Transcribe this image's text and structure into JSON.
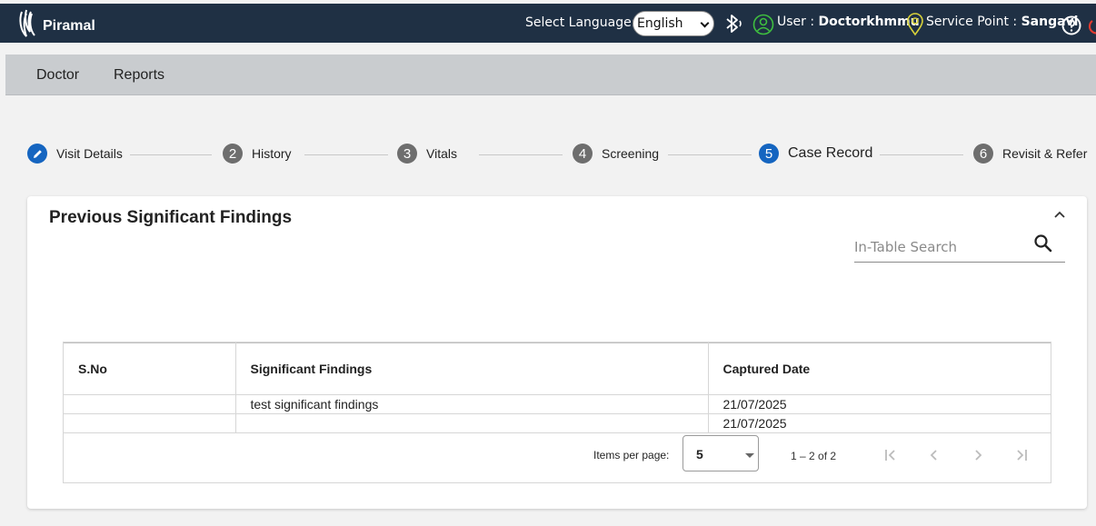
{
  "header": {
    "brand": "Piramal",
    "language_label": "Select Language:",
    "language_value": "English",
    "user_label": "User :",
    "user_name": "Doctorkhmmu",
    "service_point_label": "Service Point :",
    "service_point_name": "Sangavi",
    "colors": {
      "bar": "#1f3044",
      "icon_green": "#3fbf3f",
      "icon_yellow": "#d8d23a",
      "power": "#e03a2f"
    }
  },
  "nav": {
    "items": [
      "Doctor",
      "Reports"
    ]
  },
  "stepper": {
    "steps": [
      {
        "number": "",
        "label": "Visit Details",
        "state": "edit",
        "icon": "pencil-icon"
      },
      {
        "number": "2",
        "label": "History",
        "state": "default"
      },
      {
        "number": "3",
        "label": "Vitals",
        "state": "default"
      },
      {
        "number": "4",
        "label": "Screening",
        "state": "default"
      },
      {
        "number": "5",
        "label": "Case Record",
        "state": "active"
      },
      {
        "number": "6",
        "label": "Revisit & Refer",
        "state": "default"
      }
    ],
    "active_color": "#1565c0"
  },
  "card": {
    "title": "Previous Significant Findings",
    "search_placeholder": "In-Table Search",
    "table": {
      "columns": [
        "S.No",
        "Significant Findings",
        "Captured Date"
      ],
      "rows": [
        [
          "",
          "test significant findings",
          "21/07/2025"
        ],
        [
          "",
          "",
          "21/07/2025"
        ]
      ]
    },
    "paginator": {
      "items_per_page_label": "Items per page:",
      "items_per_page_value": "5",
      "range": "1 – 2 of 2"
    }
  }
}
